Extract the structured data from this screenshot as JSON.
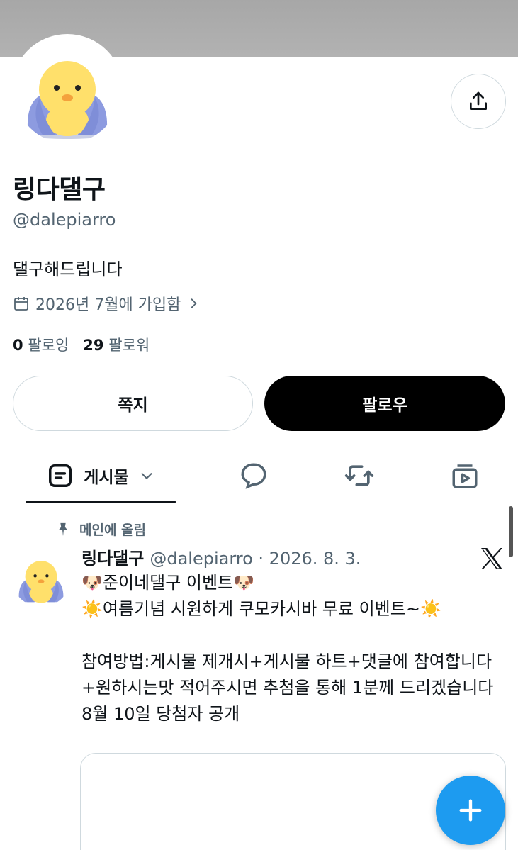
{
  "profile": {
    "name": "링다댈구",
    "handle": "@dalepiarro",
    "bio": "댈구해드립니다",
    "joined": "2026년 7월에 가입함",
    "following_count": "0",
    "following_label": "팔로잉",
    "followers_count": "29",
    "followers_label": "팔로워"
  },
  "actions": {
    "message_label": "쪽지",
    "follow_label": "팔로우"
  },
  "tabs": {
    "posts_label": "게시물"
  },
  "post": {
    "pinned_label": "메인에 올림",
    "author_name": "링다댈구",
    "author_meta": "@dalepiarro · 2026. 8. 3.",
    "body": "🐶준이네댈구 이벤트🐶\n☀️여름기념 시원하게 쿠모카시바 무료 이벤트~☀️\n\n참여방법:게시물 제개시+게시물 하트+댓글에 참여합니다+원하시는맛 적어주시면 추첨을 통해 1분께 드리겠습니다\n8월 10일 당첨자 공개"
  },
  "colors": {
    "accent": "#1d9bf0",
    "text_primary": "#0f1419",
    "text_secondary": "#536471",
    "border": "#cfd9de"
  },
  "icons": [
    "share-icon",
    "calendar-icon",
    "chevron-right-icon",
    "posts-icon",
    "chevron-down-icon",
    "reply-icon",
    "repost-icon",
    "media-icon",
    "pin-icon",
    "x-logo-icon",
    "plus-icon"
  ]
}
